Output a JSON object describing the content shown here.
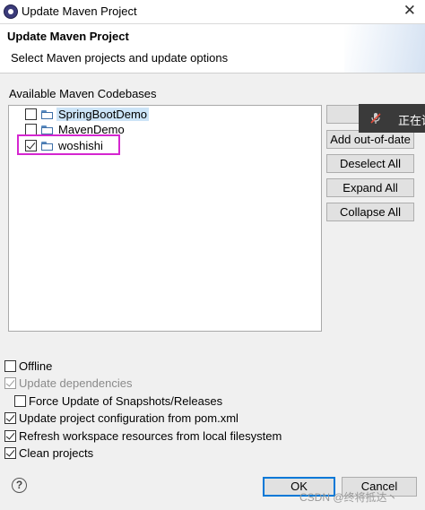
{
  "window": {
    "title": "Update Maven Project"
  },
  "header": {
    "title": "Update Maven Project",
    "description": "Select Maven projects and update options"
  },
  "codebases": {
    "label": "Available Maven Codebases",
    "projects": [
      {
        "name": "SpringBootDemo",
        "checked": false,
        "selected": true
      },
      {
        "name": "MavenDemo",
        "checked": false,
        "selected": false
      },
      {
        "name": "woshishi",
        "checked": true,
        "selected": false
      }
    ]
  },
  "buttons": {
    "select_all_visible": "Se",
    "add_out_of_date": "Add out-of-date",
    "deselect_all": "Deselect All",
    "expand_all": "Expand All",
    "collapse_all": "Collapse All",
    "ok": "OK",
    "cancel": "Cancel"
  },
  "overlay": {
    "text": "正在讲"
  },
  "options": {
    "offline": {
      "label": "Offline",
      "checked": false
    },
    "update_dependencies": {
      "label": "Update dependencies",
      "checked": true,
      "disabled": true
    },
    "force_update": {
      "label": "Force Update of Snapshots/Releases",
      "checked": false
    },
    "update_config": {
      "label": "Update project configuration from pom.xml",
      "checked": true
    },
    "refresh_workspace": {
      "label": "Refresh workspace resources from local filesystem",
      "checked": true
    },
    "clean_projects": {
      "label": "Clean projects",
      "checked": true
    }
  },
  "help": {
    "glyph": "?"
  },
  "watermark": "CSDN @终将抵达丶",
  "colors": {
    "highlight": "#d526d0",
    "selection": "#cce4f7",
    "default_button_border": "#0078d7"
  }
}
